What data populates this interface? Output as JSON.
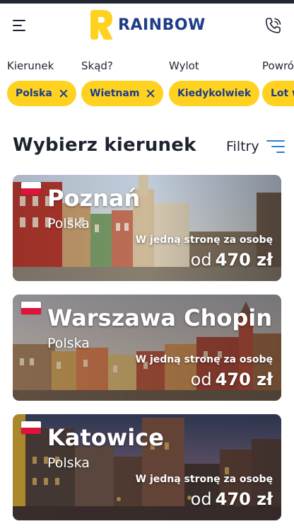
{
  "header": {
    "brand": "RAINBOW",
    "menu_icon": "hamburger-menu-icon",
    "phone_icon": "phone-icon"
  },
  "filters": [
    {
      "label": "Kierunek",
      "value": "Polska",
      "removable": true
    },
    {
      "label": "Skąd?",
      "value": "Wietnam",
      "removable": true
    },
    {
      "label": "Wylot",
      "value": "Kiedykolwiek",
      "removable": false
    },
    {
      "label": "Powrót",
      "value": "Lot w",
      "removable": false
    }
  ],
  "section": {
    "title": "Wybierz kierunek",
    "filter_label": "Filtry",
    "filter_icon": "filter-lines-icon"
  },
  "destinations": [
    {
      "city": "Poznań",
      "country": "Polska",
      "note": "W jedną stronę za osobę",
      "from": "od",
      "price": "470 zł"
    },
    {
      "city": "Warszawa Chopin",
      "country": "Polska",
      "note": "W jedną stronę za osobę",
      "from": "od",
      "price": "470 zł"
    },
    {
      "city": "Katowice",
      "country": "Polska",
      "note": "W jedną stronę za osobę",
      "from": "od",
      "price": "470 zł"
    }
  ],
  "colors": {
    "brand_yellow": "#ffd21f",
    "brand_navy": "#1f3c8a",
    "accent_blue": "#2a7fd4",
    "flag_red": "#dc143c"
  }
}
